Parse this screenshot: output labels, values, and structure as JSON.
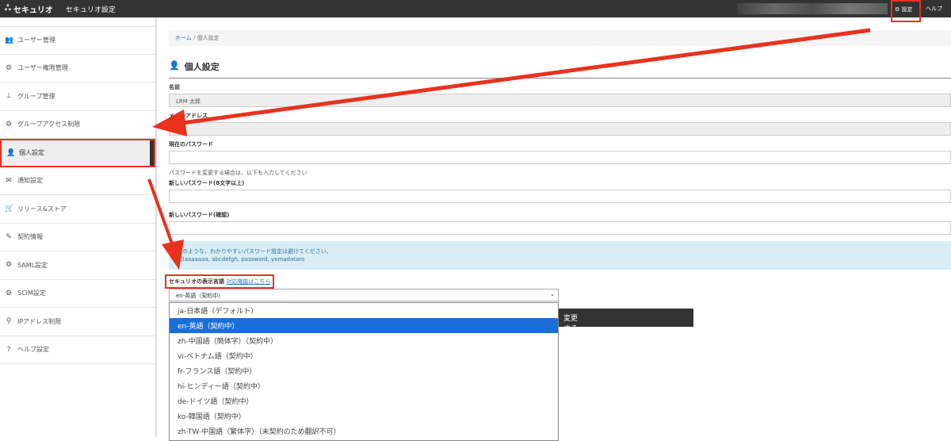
{
  "header": {
    "logo": "セキュリオ",
    "title": "セキュリオ設定",
    "settings": "設定",
    "help": "ヘルプ"
  },
  "sidebar": {
    "items": [
      {
        "label": "ユーザー管理",
        "icon": "users-icon",
        "glyph": "👥"
      },
      {
        "label": "ユーザー権限管理",
        "icon": "gear-icon",
        "glyph": "⚙"
      },
      {
        "label": "グループ管理",
        "icon": "sitemap-icon",
        "glyph": "⊥"
      },
      {
        "label": "グループアクセス制限",
        "icon": "gear-icon",
        "glyph": "⚙"
      },
      {
        "label": "個人設定",
        "icon": "user-icon",
        "glyph": "👤"
      },
      {
        "label": "通知設定",
        "icon": "envelope-icon",
        "glyph": "✉"
      },
      {
        "label": "リリース&ストア",
        "icon": "cart-icon",
        "glyph": "🛒"
      },
      {
        "label": "契約情報",
        "icon": "contract-icon",
        "glyph": "✎"
      },
      {
        "label": "SAML設定",
        "icon": "gears-icon",
        "glyph": "⚙"
      },
      {
        "label": "SCIM設定",
        "icon": "gears-icon",
        "glyph": "⚙"
      },
      {
        "label": "IPアドレス制限",
        "icon": "marker-icon",
        "glyph": "⚲"
      },
      {
        "label": "ヘルプ設定",
        "icon": "question-icon",
        "glyph": "?"
      }
    ]
  },
  "breadcrumb": {
    "home": "ホーム",
    "sep": "/",
    "current": "個人設定"
  },
  "page": {
    "title": "個人設定",
    "name_label": "名前",
    "name_value": "LRM 太郎",
    "email_label": "メールアドレス",
    "current_pw_label": "現在のパスワード",
    "pw_note": "パスワードを変更する場合は、以下も入力してください",
    "new_pw_label": "新しいパスワード(8文字以上)",
    "confirm_pw_label": "新しいパスワード(確認)",
    "alert_line1": "次のような、わかりやすいパスワード設定は避けてください。",
    "alert_line2": "例)aaaaaaa, abcdefgh, password, yamadataro",
    "lang_label": "セキュリオの表示言語",
    "lang_link": "対応機能はこちら",
    "lang_selected": "en-英語（契約中）",
    "submit": "変更する"
  },
  "dropdown": {
    "options": [
      "ja-日本語（デフォルト）",
      "en-英語（契約中）",
      "zh-中国語（簡体字）（契約中）",
      "vi-ベトナム語（契約中）",
      "fr-フランス語（契約中）",
      "hi-ヒンディー語（契約中）",
      "de-ドイツ語（契約中）",
      "ko-韓国語（契約中）",
      "zh-TW-中国語（繁体字）（未契約のため翻訳不可）"
    ]
  },
  "colors": {
    "accent": "#1a6ed8",
    "annotation": "#e8321e",
    "topbar": "#333333"
  }
}
